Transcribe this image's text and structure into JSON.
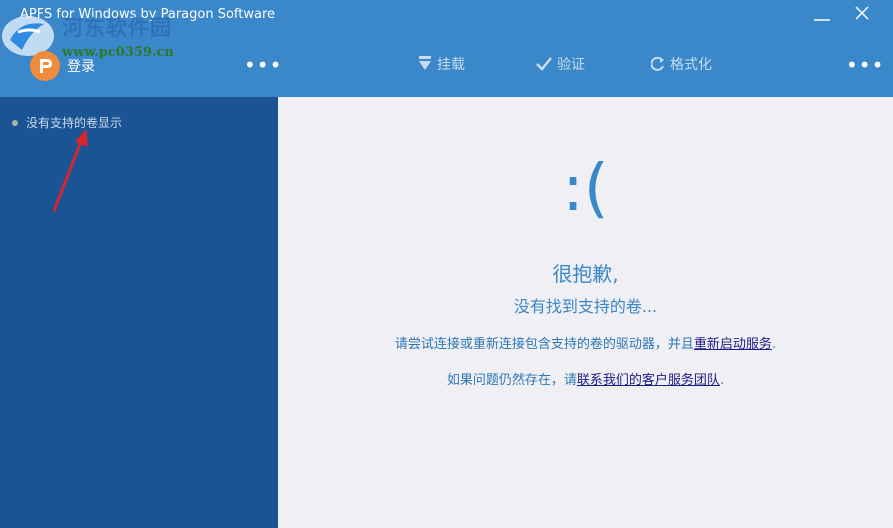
{
  "window": {
    "title": "APFS for Windows by Paragon Software",
    "minimize_icon": "minimize-icon",
    "close_icon": "close-icon"
  },
  "watermark": {
    "name": "河东软件园",
    "url": "www.pc0359.cn"
  },
  "toolbar": {
    "login_label": "登录",
    "more_left": "•••",
    "mount_label": "挂载",
    "verify_label": "验证",
    "format_label": "格式化",
    "more_right": "•••"
  },
  "sidebar": {
    "empty_label": "没有支持的卷显示"
  },
  "main": {
    "face": ":(",
    "sorry": "很抱歉,",
    "not_found": "没有找到支持的卷...",
    "line1_prefix": "请尝试连接或重新连接包含支持的卷的驱动器，并且",
    "line1_link": "重新启动服务",
    "line1_suffix": ".",
    "line2_prefix": "如果问题仍然存在，请",
    "line2_link": "联系我们的客户服务团队",
    "line2_suffix": "."
  },
  "colors": {
    "titlebar": "#3a87c9",
    "sidebar": "#1b5494",
    "main_bg": "#f0eff3",
    "accent": "#3a87c9",
    "link": "#1b1b8c",
    "annotation_arrow": "#d7262b"
  }
}
